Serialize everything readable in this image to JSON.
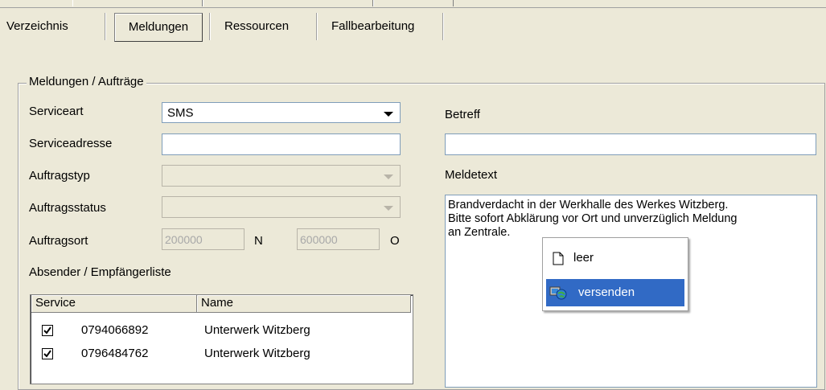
{
  "tabs": [
    "Verzeichnis",
    "Meldungen",
    "Ressourcen",
    "Fallbearbeitung"
  ],
  "group_title": "Meldungen / Aufträge",
  "form": {
    "serviceart_label": "Serviceart",
    "serviceart_value": "SMS",
    "serviceadresse_label": "Serviceadresse",
    "serviceadresse_value": "",
    "auftragstyp_label": "Auftragstyp",
    "auftragsstatus_label": "Auftragsstatus",
    "auftragsort_label": "Auftragsort",
    "auftragsort_n_value": "200000",
    "n_label": "N",
    "auftragsort_o_value": "600000",
    "o_label": "O",
    "list_title": "Absender / Empfängerliste"
  },
  "list": {
    "columns": [
      "Service",
      "Name"
    ],
    "rows": [
      {
        "checked": true,
        "service": "0794066892",
        "name": "Unterwerk Witzberg"
      },
      {
        "checked": true,
        "service": "0796484762",
        "name": "Unterwerk Witzberg"
      }
    ]
  },
  "right": {
    "betreff_label": "Betreff",
    "betreff_value": "",
    "meldetext_label": "Meldetext",
    "meldetext": "Brandverdacht in der Werkhalle des Werkes Witzberg.\nBitte sofort Abklärung vor Ort und unverzüglich Meldung\nan Zentrale."
  },
  "context_menu": {
    "items": [
      {
        "label": "leer",
        "icon": "blank-document-icon"
      },
      {
        "label": "versenden",
        "icon": "send-globe-icon",
        "selected": true
      }
    ]
  },
  "colors": {
    "selection": "#316ac5",
    "window": "#ece9d8"
  }
}
